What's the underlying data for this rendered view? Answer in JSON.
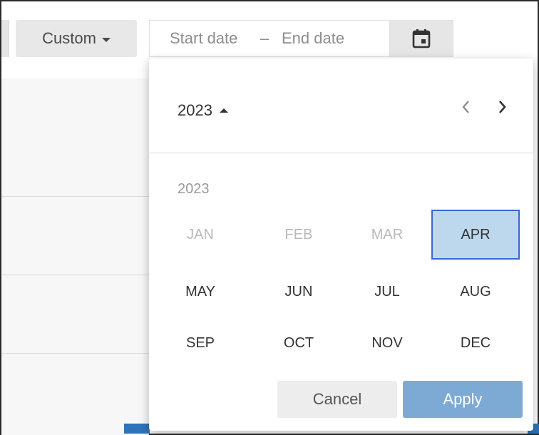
{
  "toolbar": {
    "range_mode_label": "Custom",
    "start_placeholder": "Start date",
    "separator": "–",
    "end_placeholder": "End date",
    "calendar_icon": "calendar-icon"
  },
  "picker": {
    "header_year": "2023",
    "grid_year": "2023",
    "months": [
      {
        "label": "JAN",
        "state": "disabled"
      },
      {
        "label": "FEB",
        "state": "disabled"
      },
      {
        "label": "MAR",
        "state": "disabled"
      },
      {
        "label": "APR",
        "state": "selected"
      },
      {
        "label": "MAY",
        "state": "normal"
      },
      {
        "label": "JUN",
        "state": "normal"
      },
      {
        "label": "JUL",
        "state": "normal"
      },
      {
        "label": "AUG",
        "state": "normal"
      },
      {
        "label": "SEP",
        "state": "normal"
      },
      {
        "label": "OCT",
        "state": "normal"
      },
      {
        "label": "NOV",
        "state": "normal"
      },
      {
        "label": "DEC",
        "state": "normal"
      }
    ],
    "cancel_label": "Cancel",
    "apply_label": "Apply"
  },
  "colors": {
    "accent": "#3a66d6",
    "selected_fill": "#bdd7ec",
    "apply_fill": "#7da9d5"
  }
}
